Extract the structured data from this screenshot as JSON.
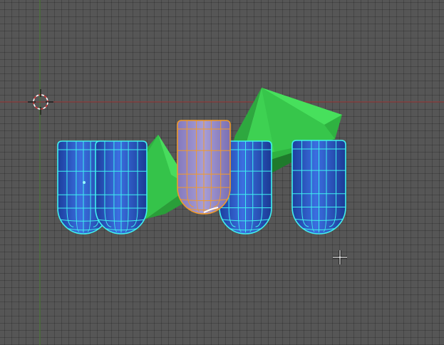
{
  "viewport": {
    "background": "#565656",
    "grid_line_color": "#4a4a4a",
    "x_axis_color": "#8f3d3d",
    "z_axis_color": "#4e7a38"
  },
  "objects": [
    {
      "name": "pyramid-left",
      "kind": "pyramid",
      "color": "#3bd44f",
      "selected": false
    },
    {
      "name": "pyramid-right",
      "kind": "pyramid",
      "color": "#3bd44f",
      "selected": false
    },
    {
      "name": "capsule-1",
      "kind": "capsule",
      "color": "#2a58c8",
      "wire_color": "#3ff0f0",
      "selected": true
    },
    {
      "name": "capsule-2",
      "kind": "capsule",
      "color": "#2a58c8",
      "wire_color": "#3ff0f0",
      "selected": true
    },
    {
      "name": "capsule-active",
      "kind": "capsule",
      "color": "#9387c7",
      "wire_color": "#f19a2b",
      "selected": true,
      "active": true
    },
    {
      "name": "capsule-4",
      "kind": "capsule",
      "color": "#2a58c8",
      "wire_color": "#3ff0f0",
      "selected": true
    },
    {
      "name": "capsule-5",
      "kind": "capsule",
      "color": "#2a58c8",
      "wire_color": "#3ff0f0",
      "selected": true
    }
  ],
  "icons": {
    "cursor_3d": "3d-cursor-icon",
    "mouse_cursor": "crosshair-cursor-icon"
  }
}
